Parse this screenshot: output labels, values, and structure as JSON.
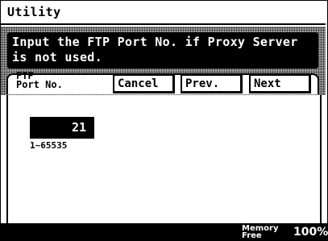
{
  "window": {
    "title": "Utility"
  },
  "message": {
    "text": "Input the FTP Port No. if Proxy Server\nis not used."
  },
  "tab": {
    "label": "FTP\nPort No."
  },
  "buttons": {
    "cancel": "Cancel",
    "prev": "Prev.",
    "next": "Next"
  },
  "field": {
    "value": "21",
    "range": "1~65535"
  },
  "status": {
    "memory_label": "Memory\nFree",
    "memory_value": "100%"
  },
  "colors": {
    "background": "#ffffff",
    "foreground": "#000000",
    "pattern": "#9a9a9a"
  }
}
